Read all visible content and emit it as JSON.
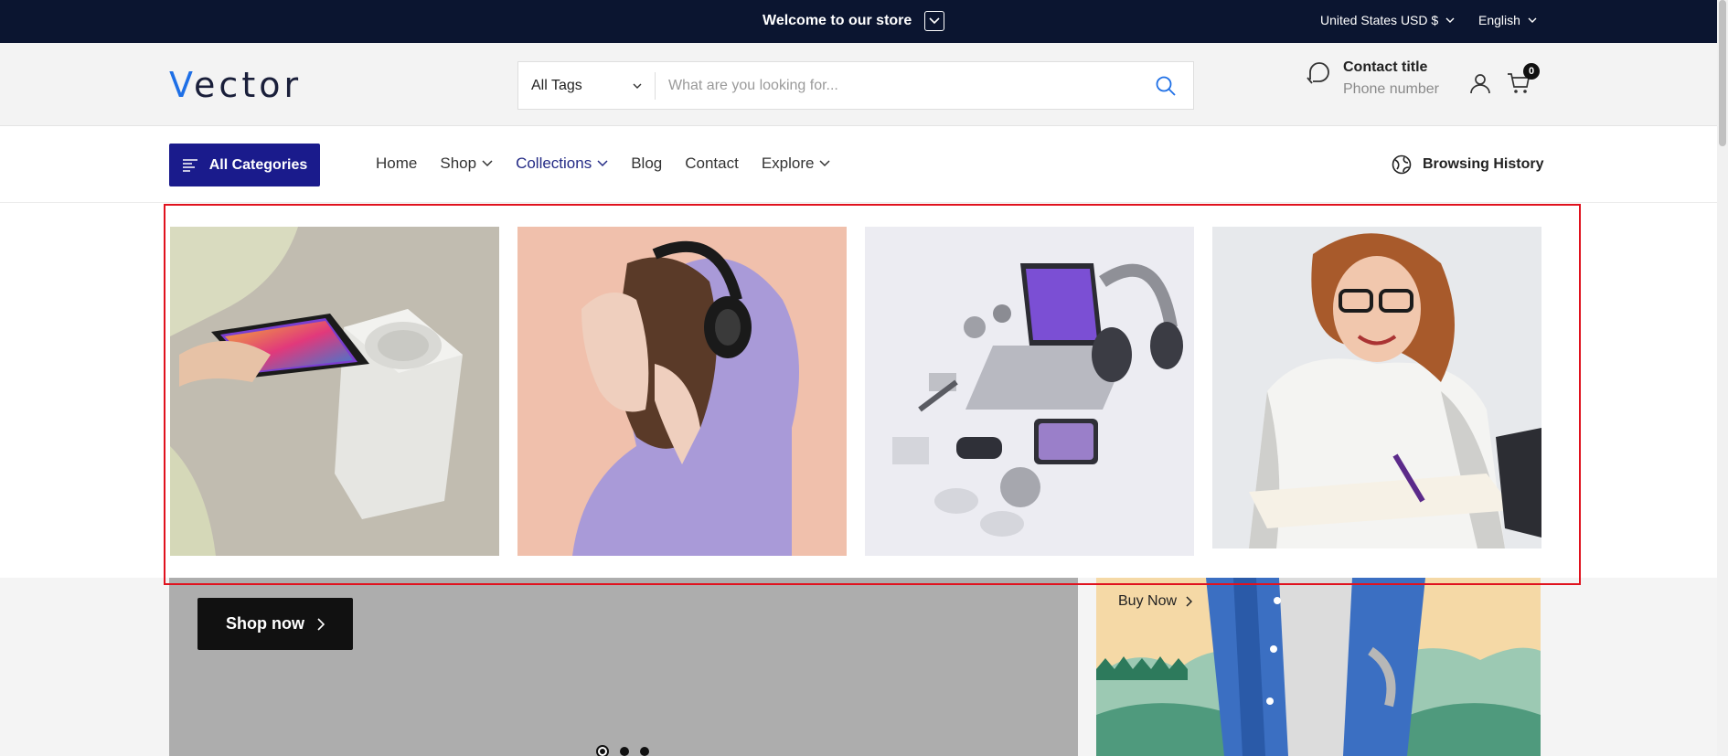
{
  "topbar": {
    "welcome": "Welcome to our store",
    "currency": "United States USD $",
    "language": "English"
  },
  "header": {
    "logo_first": "V",
    "logo_rest": "ector",
    "search_category": "All Tags",
    "search_placeholder": "What are you looking for...",
    "contact_title": "Contact title",
    "contact_phone": "Phone number",
    "cart_count": "0"
  },
  "nav": {
    "all_categories": "All Categories",
    "links": [
      {
        "label": "Home",
        "dropdown": false
      },
      {
        "label": "Shop",
        "dropdown": true
      },
      {
        "label": "Collections",
        "dropdown": true,
        "active": true
      },
      {
        "label": "Blog",
        "dropdown": false
      },
      {
        "label": "Contact",
        "dropdown": false
      },
      {
        "label": "Explore",
        "dropdown": true
      }
    ],
    "browsing_history": "Browsing History"
  },
  "collections_menu": {
    "tiles": [
      {
        "image": "smartphone-and-smart-speaker-photo"
      },
      {
        "image": "woman-wearing-headphones-photo"
      },
      {
        "image": "laptop-and-gadgets-flatlay-photo"
      },
      {
        "image": "smiling-woman-writing-photo"
      }
    ]
  },
  "hero": {
    "shop_now": "Shop now",
    "slides": 3,
    "active_slide": 1
  },
  "promo": {
    "buy_now": "Buy Now"
  },
  "colors": {
    "topbar_bg": "#0b1530",
    "primary_button": "#1a1b8c",
    "logo_accent": "#1e6fe6",
    "highlight_border": "#e0121e"
  }
}
